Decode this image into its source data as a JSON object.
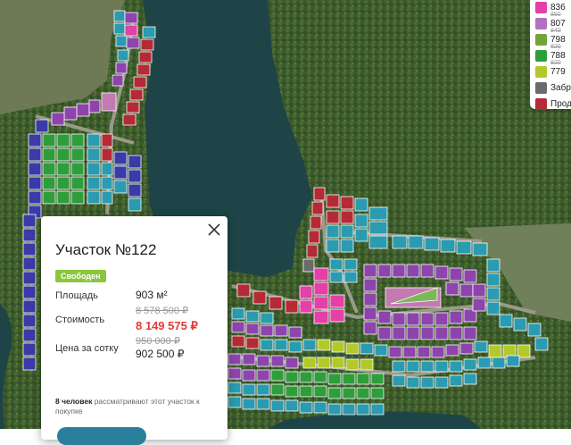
{
  "legend": {
    "rows": [
      {
        "color": "#e53fa9",
        "old": "",
        "value": "836"
      },
      {
        "color": "#b46fc0",
        "old": "850",
        "value": "807"
      },
      {
        "color": "#74a33a",
        "old": "840",
        "value": "798"
      },
      {
        "color": "#2d9e3a",
        "old": "820",
        "value": "788"
      },
      {
        "color": "#b3c929",
        "old": "820",
        "value": "779"
      },
      {
        "color": "#6b6b6b",
        "old": "",
        "value": "Забр"
      },
      {
        "color": "#b52a35",
        "old": "",
        "value": "Прод"
      }
    ]
  },
  "popup": {
    "title": "Участок №122",
    "status": "Свободен",
    "area_label": "Площадь",
    "area_value": "903 м²",
    "price_label": "Стоимость",
    "price_old": "8 578 500 ₽",
    "price_new": "8 149 575 ₽",
    "sotka_label": "Цена за сотку",
    "sotka_old": "950 000 ₽",
    "sotka_new": "902 500 ₽",
    "viewers_count": "8 человек",
    "viewers_text": "рассматривают этот участок к покупке"
  },
  "colors": {
    "accent_green": "#8cc63f",
    "price_red": "#e53935",
    "free_teal": "#2a9bb0",
    "sold_red": "#b52a35",
    "premium_pink": "#e53fa9",
    "purple": "#8e44ad",
    "green": "#2d9e3a",
    "olive": "#b3c929"
  }
}
